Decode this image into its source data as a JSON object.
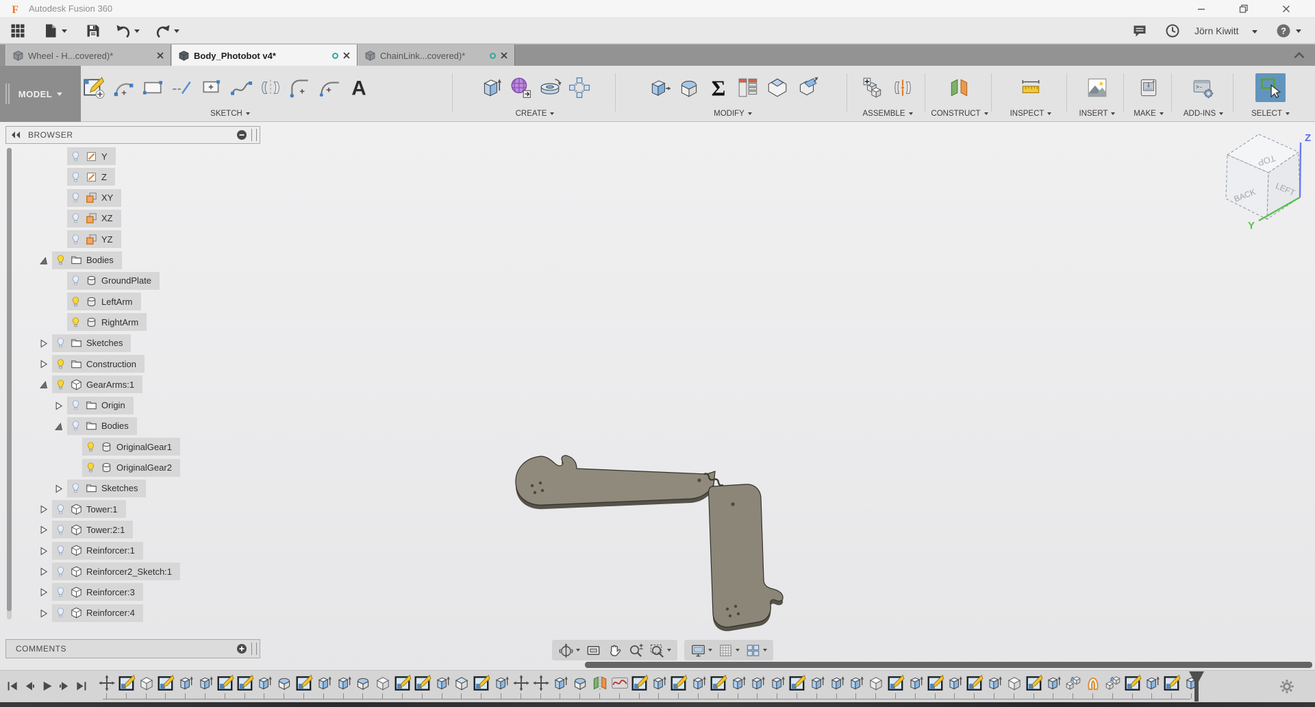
{
  "window": {
    "title": "Autodesk Fusion 360"
  },
  "app_toolbar": {
    "user_name": "Jörn Kiwitt",
    "left_icons": [
      "app-grid",
      "file-menu",
      "save",
      "undo",
      "redo"
    ],
    "right_icons": [
      "comments-bubble",
      "job-status-clock",
      "user-account",
      "help"
    ]
  },
  "tabs": [
    {
      "label": "Wheel - H...covered)*",
      "active": false,
      "unsaved_indicator": false
    },
    {
      "label": "Body_Photobot v4*",
      "active": true,
      "unsaved_indicator": true
    },
    {
      "label": "ChainLink...covered)*",
      "active": false,
      "unsaved_indicator": true
    }
  ],
  "ribbon": {
    "workspace_label": "MODEL",
    "groups": [
      {
        "label": "SKETCH",
        "icons": [
          "create-sketch",
          "arc",
          "rectangle",
          "line",
          "center-rectangle",
          "spline",
          "mirror-sketch",
          "sketch-fillet",
          "tangent-arc",
          "text"
        ]
      },
      {
        "label": "CREATE",
        "icons": [
          "extrude",
          "form",
          "revolve",
          "pattern"
        ]
      },
      {
        "label": "MODIFY",
        "icons": [
          "press-pull",
          "fillet",
          "parameters",
          "change-parameters",
          "chamfer",
          "split"
        ]
      },
      {
        "label": "ASSEMBLE",
        "icons": [
          "new-component",
          "joint"
        ]
      },
      {
        "label": "CONSTRUCT",
        "icons": [
          "construct-plane"
        ]
      },
      {
        "label": "INSPECT",
        "icons": [
          "measure"
        ]
      },
      {
        "label": "INSERT",
        "icons": [
          "insert-image"
        ]
      },
      {
        "label": "MAKE",
        "icons": [
          "print"
        ]
      },
      {
        "label": "ADD-INS",
        "icons": [
          "add-ins"
        ]
      },
      {
        "label": "SELECT",
        "icons": [
          "select"
        ]
      }
    ]
  },
  "browser": {
    "title": "BROWSER",
    "rows": [
      {
        "label": "Y",
        "indent": 2,
        "icon": "axis",
        "bulb": "off",
        "exp": null
      },
      {
        "label": "Z",
        "indent": 2,
        "icon": "axis",
        "bulb": "off",
        "exp": null
      },
      {
        "label": "XY",
        "indent": 2,
        "icon": "plane",
        "bulb": "off",
        "exp": null
      },
      {
        "label": "XZ",
        "indent": 2,
        "icon": "plane",
        "bulb": "off",
        "exp": null
      },
      {
        "label": "YZ",
        "indent": 2,
        "icon": "plane",
        "bulb": "off",
        "exp": null
      },
      {
        "label": "Bodies",
        "indent": 1,
        "icon": "folder",
        "bulb": "on",
        "exp": "open"
      },
      {
        "label": "GroundPlate",
        "indent": 2,
        "icon": "body",
        "bulb": "off",
        "exp": null
      },
      {
        "label": "LeftArm",
        "indent": 2,
        "icon": "body",
        "bulb": "on",
        "exp": null
      },
      {
        "label": "RightArm",
        "indent": 2,
        "icon": "body",
        "bulb": "on",
        "exp": null
      },
      {
        "label": "Sketches",
        "indent": 1,
        "icon": "folder",
        "bulb": "off",
        "exp": "closed"
      },
      {
        "label": "Construction",
        "indent": 1,
        "icon": "folder",
        "bulb": "on",
        "exp": "closed"
      },
      {
        "label": "GearArms:1",
        "indent": 1,
        "icon": "component",
        "bulb": "on",
        "exp": "open"
      },
      {
        "label": "Origin",
        "indent": 2,
        "icon": "folder",
        "bulb": "off",
        "exp": "closed"
      },
      {
        "label": "Bodies",
        "indent": 2,
        "icon": "folder",
        "bulb": "off",
        "exp": "open"
      },
      {
        "label": "OriginalGear1",
        "indent": 3,
        "icon": "body",
        "bulb": "on",
        "exp": null
      },
      {
        "label": "OriginalGear2",
        "indent": 3,
        "icon": "body",
        "bulb": "on",
        "exp": null
      },
      {
        "label": "Sketches",
        "indent": 2,
        "icon": "folder",
        "bulb": "off",
        "exp": "closed"
      },
      {
        "label": "Tower:1",
        "indent": 1,
        "icon": "component",
        "bulb": "off",
        "exp": "closed"
      },
      {
        "label": "Tower:2:1",
        "indent": 1,
        "icon": "component",
        "bulb": "off",
        "exp": "closed"
      },
      {
        "label": "Reinforcer:1",
        "indent": 1,
        "icon": "component",
        "bulb": "off",
        "exp": "closed"
      },
      {
        "label": "Reinforcer2_Sketch:1",
        "indent": 1,
        "icon": "component",
        "bulb": "off",
        "exp": "closed"
      },
      {
        "label": "Reinforcer:3",
        "indent": 1,
        "icon": "component",
        "bulb": "off",
        "exp": "closed"
      },
      {
        "label": "Reinforcer:4",
        "indent": 1,
        "icon": "component",
        "bulb": "off",
        "exp": "closed"
      }
    ]
  },
  "comments": {
    "title": "COMMENTS"
  },
  "viewcube": {
    "faces": {
      "top": "TOP",
      "back": "BACK",
      "left": "LEFT"
    },
    "axes": {
      "z": "Z",
      "y": "Y"
    }
  },
  "nav_toolbar": {
    "groups": [
      {
        "icons": [
          {
            "name": "orbit",
            "caret": true
          },
          {
            "name": "look-at",
            "caret": false
          },
          {
            "name": "pan",
            "caret": false
          },
          {
            "name": "zoom",
            "caret": false
          },
          {
            "name": "window-zoom",
            "caret": true
          }
        ]
      },
      {
        "icons": [
          {
            "name": "display-settings",
            "caret": true
          },
          {
            "name": "grid-display",
            "caret": true
          },
          {
            "name": "viewports",
            "caret": true
          }
        ]
      }
    ]
  },
  "timeline": {
    "playback": [
      "go-to-start",
      "step-back",
      "play",
      "step-forward",
      "go-to-end"
    ],
    "features": [
      "move",
      "sketch",
      "component",
      "sketch",
      "extrude",
      "extrude",
      "sketch",
      "sketch",
      "extrude",
      "fillet",
      "sketch",
      "extrude",
      "extrude",
      "fillet",
      "component",
      "sketch",
      "sketch",
      "extrude",
      "chamfer",
      "sketch",
      "extrude",
      "move",
      "move",
      "extrude",
      "fillet",
      "mirror",
      "curve",
      "sketch",
      "extrude",
      "sketch",
      "extrude",
      "sketch",
      "extrude",
      "extrude",
      "extrude",
      "sketch",
      "extrude",
      "extrude",
      "extrude",
      "component",
      "sketch",
      "extrude",
      "sketch",
      "extrude",
      "sketch",
      "extrude",
      "component",
      "sketch",
      "extrude",
      "copy",
      "hole",
      "copy",
      "sketch",
      "extrude",
      "sketch",
      "extrude"
    ],
    "settings_icon": "gear"
  },
  "colors": {
    "accent_teal": "#2fa79e",
    "selection_blue": "#6295bd",
    "plane_orange": "#f2a765",
    "model_body": "#8f8a7c",
    "tabbar_gray": "#939393"
  }
}
